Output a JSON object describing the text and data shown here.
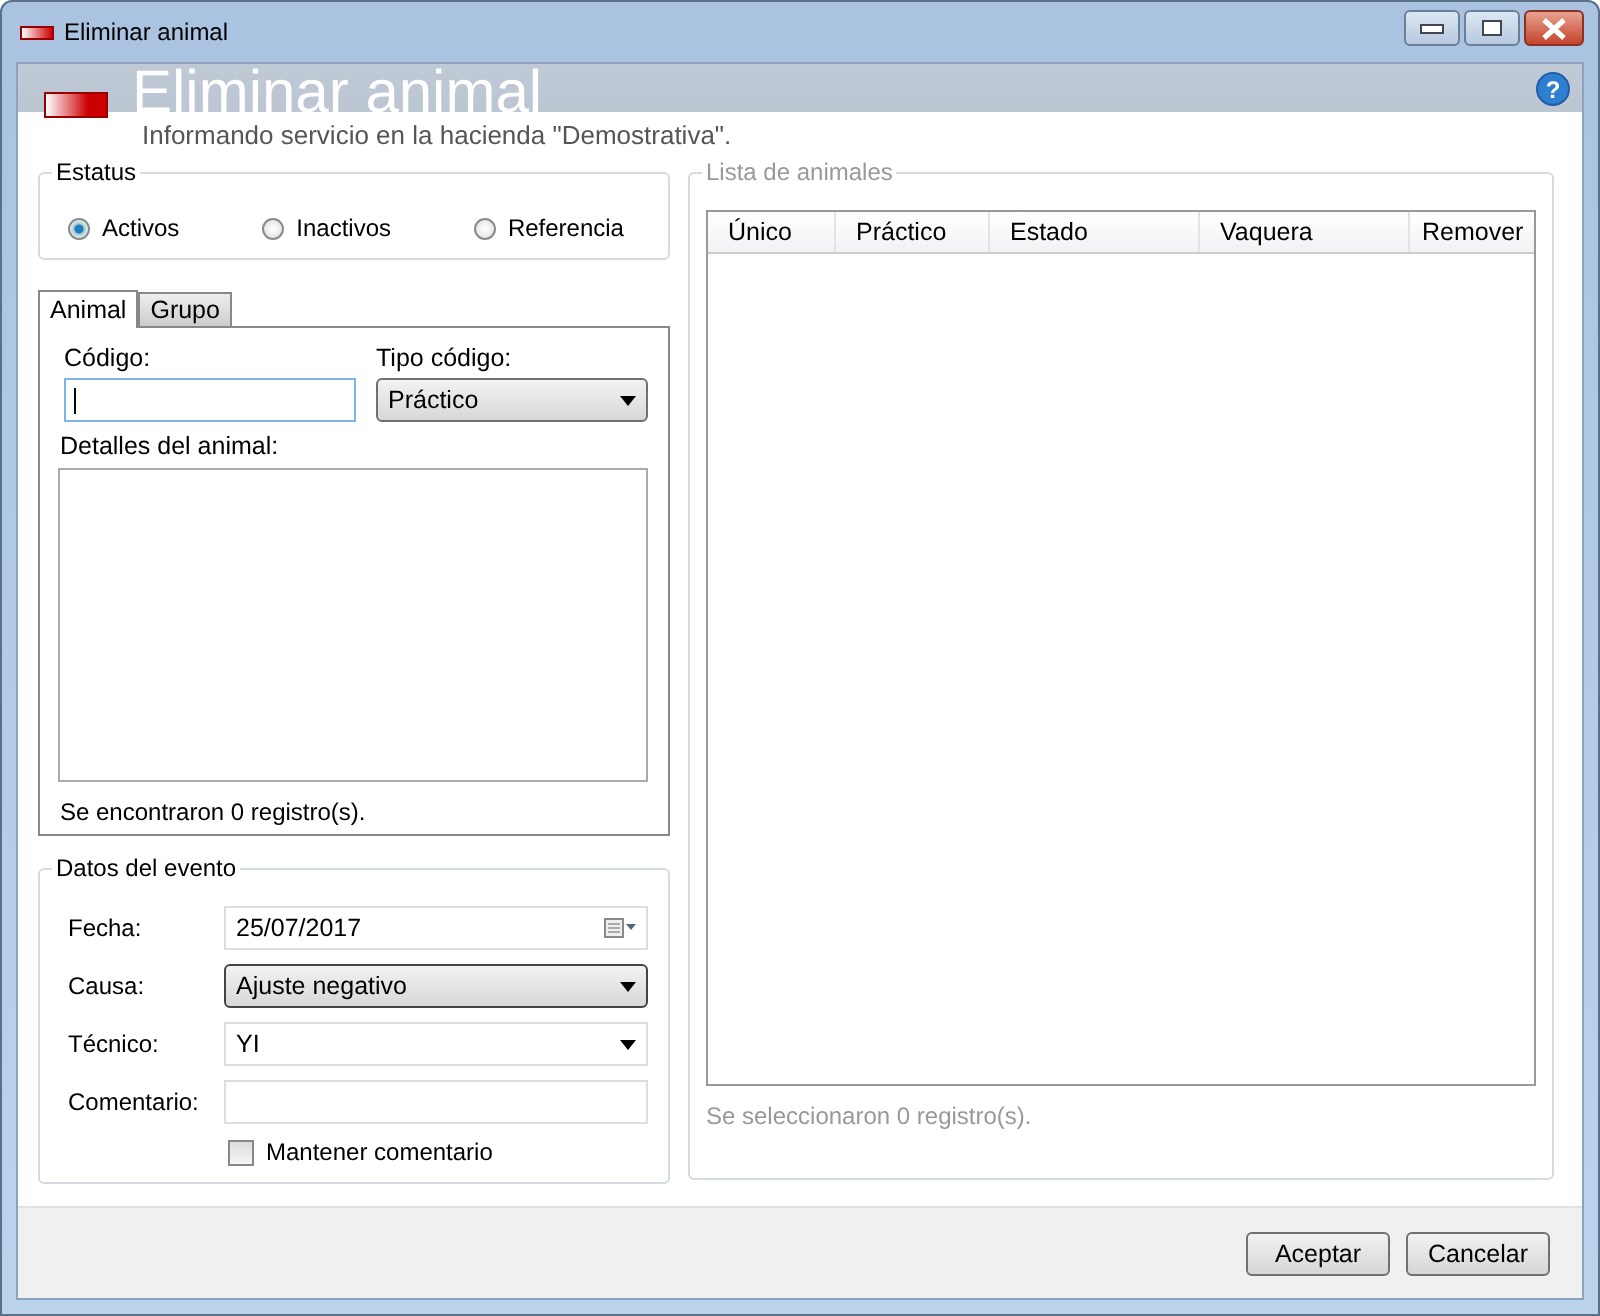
{
  "window": {
    "title": "Eliminar animal"
  },
  "header": {
    "title": "Eliminar animal",
    "subtitle": "Informando servicio en la hacienda \"Demostrativa\".",
    "help": "?"
  },
  "status_group": {
    "legend": "Estatus",
    "options": [
      {
        "label": "Activos",
        "selected": true
      },
      {
        "label": "Inactivos",
        "selected": false
      },
      {
        "label": "Referencia",
        "selected": false
      }
    ]
  },
  "tabs": [
    {
      "label": "Animal",
      "selected": true
    },
    {
      "label": "Grupo",
      "selected": false
    }
  ],
  "animal_tab": {
    "code_label": "Código:",
    "type_label": "Tipo código:",
    "type_value": "Práctico",
    "details_label": "Detalles del animal:",
    "found_text": "Se encontraron 0 registro(s)."
  },
  "event": {
    "legend": "Datos del evento",
    "fields": [
      {
        "kind": "date",
        "label": "Fecha:",
        "value": "25/07/2017"
      },
      {
        "kind": "dropdown",
        "label": "Causa:",
        "value": "Ajuste negativo"
      },
      {
        "kind": "combo",
        "label": "Técnico:",
        "value": "YI"
      },
      {
        "kind": "text",
        "label": "Comentario:"
      }
    ],
    "keep_comment": {
      "label": "Mantener comentario",
      "checked": false
    }
  },
  "animal_list": {
    "legend": "Lista de animales",
    "columns": [
      "Único",
      "Práctico",
      "Estado",
      "Vaquera",
      "Remover"
    ],
    "selected_text": "Se seleccionaron 0 registro(s)."
  },
  "buttons": [
    "Aceptar",
    "Cancelar"
  ]
}
